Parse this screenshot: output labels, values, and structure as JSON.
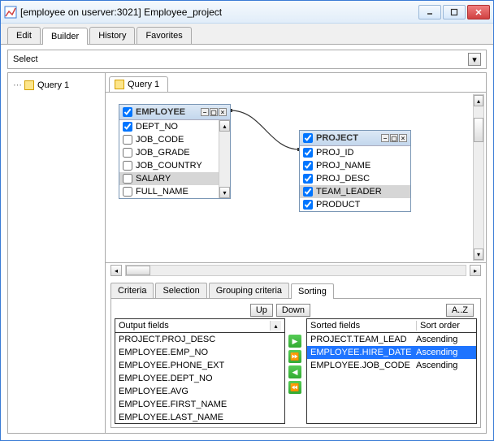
{
  "window": {
    "title": "[employee on userver:3021] Employee_project"
  },
  "tabs": {
    "edit": "Edit",
    "builder": "Builder",
    "history": "History",
    "favorites": "Favorites"
  },
  "select_label": "Select",
  "tree": {
    "query1": "Query 1"
  },
  "query_tab": "Query 1",
  "tables": {
    "employee": {
      "title": "EMPLOYEE",
      "fields": [
        {
          "name": "DEPT_NO",
          "checked": true,
          "selected": false
        },
        {
          "name": "JOB_CODE",
          "checked": false,
          "selected": false
        },
        {
          "name": "JOB_GRADE",
          "checked": false,
          "selected": false
        },
        {
          "name": "JOB_COUNTRY",
          "checked": false,
          "selected": false
        },
        {
          "name": "SALARY",
          "checked": false,
          "selected": true
        },
        {
          "name": "FULL_NAME",
          "checked": false,
          "selected": false
        }
      ]
    },
    "project": {
      "title": "PROJECT",
      "fields": [
        {
          "name": "PROJ_ID",
          "checked": true,
          "selected": false
        },
        {
          "name": "PROJ_NAME",
          "checked": true,
          "selected": false
        },
        {
          "name": "PROJ_DESC",
          "checked": true,
          "selected": false
        },
        {
          "name": "TEAM_LEADER",
          "checked": true,
          "selected": true
        },
        {
          "name": "PRODUCT",
          "checked": true,
          "selected": false
        }
      ]
    }
  },
  "bottom_tabs": {
    "criteria": "Criteria",
    "selection": "Selection",
    "grouping": "Grouping criteria",
    "sorting": "Sorting"
  },
  "sort_controls": {
    "up": "Up",
    "down": "Down",
    "az": "A..Z"
  },
  "output_header": "Output fields",
  "output_fields": [
    "PROJECT.PROJ_DESC",
    "EMPLOYEE.EMP_NO",
    "EMPLOYEE.PHONE_EXT",
    "EMPLOYEE.DEPT_NO",
    "EMPLOYEE.AVG",
    "EMPLOYEE.FIRST_NAME",
    "EMPLOYEE.LAST_NAME"
  ],
  "sorted_header1": "Sorted fields",
  "sorted_header2": "Sort order",
  "sorted_fields": [
    {
      "name": "PROJECT.TEAM_LEAD",
      "order": "Ascending",
      "selected": false
    },
    {
      "name": "EMPLOYEE.HIRE_DATE",
      "order": "Ascending",
      "selected": true
    },
    {
      "name": "EMPLOYEE.JOB_CODE",
      "order": "Ascending",
      "selected": false
    }
  ]
}
